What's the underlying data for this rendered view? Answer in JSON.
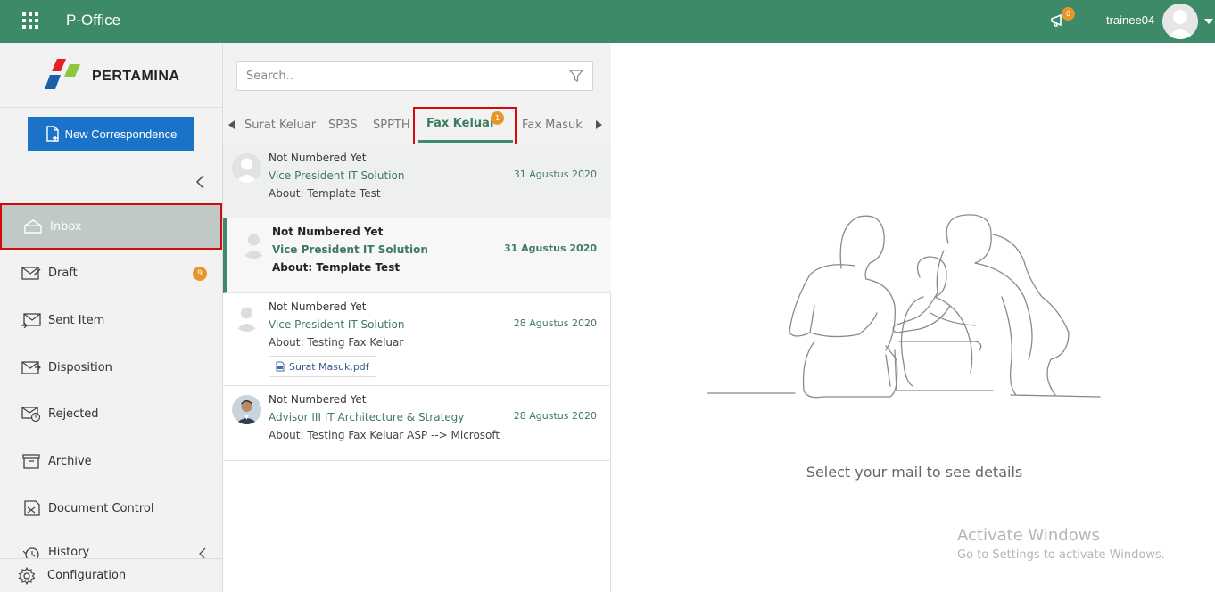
{
  "app": {
    "title": "P-Office",
    "notification_count": "0",
    "username": "trainee04"
  },
  "sidebar": {
    "logo_text": "PERTAMINA",
    "new_button": "New Correspondence",
    "items": [
      {
        "label": "Inbox",
        "icon": "inbox-icon"
      },
      {
        "label": "Draft",
        "icon": "draft-icon",
        "badge": "9"
      },
      {
        "label": "Sent Item",
        "icon": "sent-icon"
      },
      {
        "label": "Disposition",
        "icon": "disposition-icon"
      },
      {
        "label": "Rejected",
        "icon": "rejected-icon"
      },
      {
        "label": "Archive",
        "icon": "archive-icon"
      },
      {
        "label": "Document Control",
        "icon": "document-control-icon"
      },
      {
        "label": "History",
        "icon": "history-icon"
      }
    ],
    "config_label": "Configuration"
  },
  "list": {
    "search_placeholder": "Search..",
    "tabs": [
      "Surat Keluar",
      "SP3S",
      "SPPTH",
      "Fax Keluar",
      "Fax Masuk"
    ],
    "active_tab": "Fax Keluar",
    "active_tab_badge": "1",
    "mails": [
      {
        "number": "Not Numbered Yet",
        "from": "Vice President IT Solution",
        "about": "About: Template Test",
        "date": "31 Agustus 2020"
      },
      {
        "number": "Not Numbered Yet",
        "from": "Vice President IT Solution",
        "about": "About: Template Test",
        "date": "31 Agustus 2020"
      },
      {
        "number": "Not Numbered Yet",
        "from": "Vice President IT Solution",
        "about": "About: Testing Fax Keluar",
        "date": "28 Agustus 2020",
        "attachment": "Surat Masuk.pdf"
      },
      {
        "number": "Not Numbered Yet",
        "from": "Advisor III IT Architecture & Strategy",
        "about": "About: Testing Fax Keluar ASP --> Microsoft",
        "date": "28 Agustus 2020"
      }
    ]
  },
  "detail": {
    "empty_message": "Select your mail to see details",
    "watermark_title": "Activate Windows",
    "watermark_sub": "Go to Settings to activate Windows."
  },
  "colors": {
    "primary": "#3d8a68",
    "button": "#1a73c8",
    "badge": "#e8962c",
    "highlight": "#d10c0c"
  }
}
